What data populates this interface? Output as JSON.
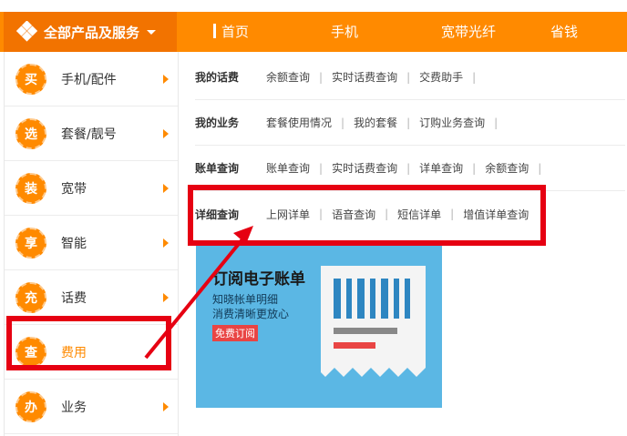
{
  "header": {
    "category_button": "全部产品及服务",
    "nav": [
      "首页",
      "手机",
      "宽带光纤",
      "省钱"
    ]
  },
  "sidebar": {
    "items": [
      {
        "badge": "买",
        "label": "手机/配件"
      },
      {
        "badge": "选",
        "label": "套餐/靓号"
      },
      {
        "badge": "装",
        "label": "宽带"
      },
      {
        "badge": "享",
        "label": "智能"
      },
      {
        "badge": "充",
        "label": "话费"
      },
      {
        "badge": "查",
        "label": "费用"
      },
      {
        "badge": "办",
        "label": "业务"
      }
    ]
  },
  "panel": {
    "rows": [
      {
        "title": "我的话费",
        "links": [
          "余额查询",
          "实时话费查询",
          "交费助手"
        ]
      },
      {
        "title": "我的业务",
        "links": [
          "套餐使用情况",
          "我的套餐",
          "订购业务查询"
        ]
      },
      {
        "title": "账单查询",
        "links": [
          "账单查询",
          "实时话费查询",
          "详单查询",
          "余额查询"
        ]
      },
      {
        "title": "详细查询",
        "links": [
          "上网详单",
          "语音查询",
          "短信详单",
          "增值详单查询"
        ]
      }
    ]
  },
  "banner": {
    "title": "订阅电子账单",
    "subtitle1": "知晓帐单明细",
    "subtitle2": "消费清晰更放心",
    "button": "免费订阅"
  },
  "colors": {
    "brand_orange": "#ff8a00",
    "highlight_red": "#e60012",
    "banner_blue": "#5bb7e4"
  }
}
